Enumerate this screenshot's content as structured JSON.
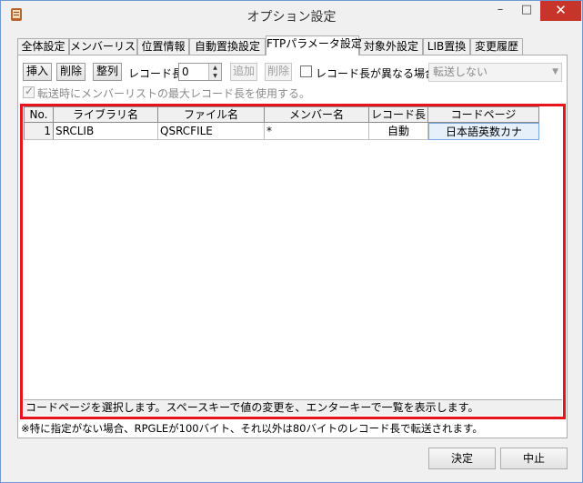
{
  "window": {
    "title": "オプション設定"
  },
  "titlebar": {
    "minimize": "–",
    "maximize": "□",
    "close": "✕"
  },
  "tabs": [
    {
      "label": "全体設定"
    },
    {
      "label": "メンバーリスト"
    },
    {
      "label": "位置情報"
    },
    {
      "label": "自動置換設定"
    },
    {
      "label": "FTPパラメータ設定",
      "active": true
    },
    {
      "label": "対象外設定"
    },
    {
      "label": "LIB置換"
    },
    {
      "label": "変更履歴"
    }
  ],
  "toolbar": {
    "insert": "挿入",
    "delete": "削除",
    "sort": "整列",
    "record_length_label": "レコード長",
    "record_length_value": "0",
    "add": "追加",
    "remove": "削除",
    "diff_record_label": "レコード長が異なる場合",
    "transfer_select": "転送しない",
    "use_max_label": "転送時にメンバーリストの最大レコード長を使用する。"
  },
  "grid": {
    "columns": [
      "No.",
      "ライブラリ名",
      "ファイル名",
      "メンバー名",
      "レコード長",
      "コードページ"
    ],
    "rows": [
      {
        "no": "1",
        "library": "SRCLIB",
        "file": "QSRCFILE",
        "member": "*",
        "record_length": "自動",
        "codepage": "日本語英数カナ"
      }
    ]
  },
  "status": {
    "text": "コードページを選択します。スペースキーで値の変更を、エンターキーで一覧を表示します。"
  },
  "note": "※特に指定がない場合、RPGLEが100バイト、それ以外は80バイトのレコード長で転送されます。",
  "footer": {
    "ok": "決定",
    "cancel": "中止"
  },
  "colors": {
    "highlight_frame": "#e8141b",
    "close_button": "#c7342a"
  }
}
